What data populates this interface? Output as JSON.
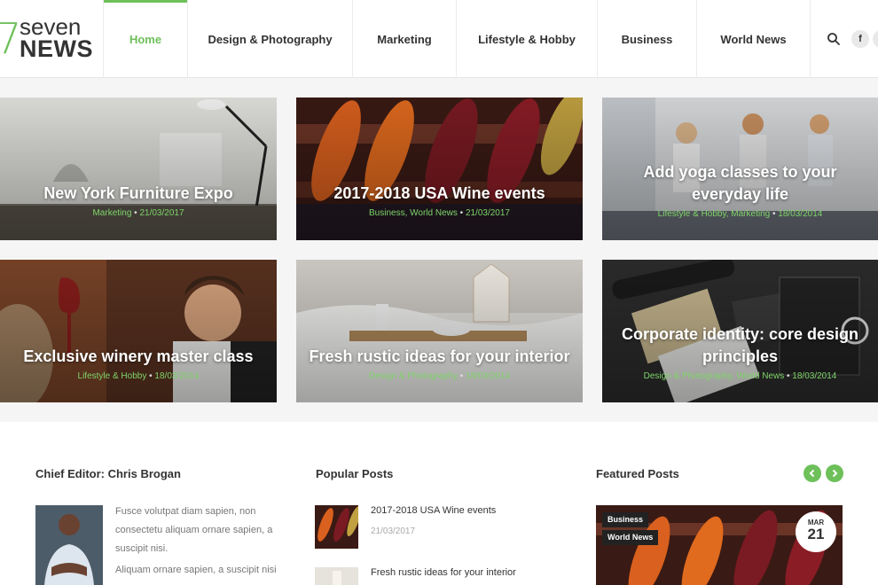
{
  "logo": {
    "line1": "seven",
    "line2": "NEWS"
  },
  "nav": [
    {
      "label": "Home",
      "active": true
    },
    {
      "label": "Design & Photography",
      "active": false
    },
    {
      "label": "Marketing",
      "active": false
    },
    {
      "label": "Lifestyle & Hobby",
      "active": false
    },
    {
      "label": "Business",
      "active": false
    },
    {
      "label": "World News",
      "active": false
    }
  ],
  "social": {
    "facebook": "f"
  },
  "tiles": [
    {
      "title": "New York Furniture Expo",
      "cats": "Marketing",
      "date": "21/03/2017"
    },
    {
      "title": "2017-2018 USA Wine events",
      "cats": "Business, World News",
      "date": "21/03/2017"
    },
    {
      "title": "Add yoga classes to your everyday life",
      "cats": "Lifestyle & Hobby, Marketing",
      "date": "18/03/2014"
    },
    {
      "title": "Exclusive winery master class",
      "cats": "Lifestyle & Hobby",
      "date": "18/03/2014"
    },
    {
      "title": "Fresh rustic ideas for your interior",
      "cats": "Design & Photography",
      "date": "18/03/2014"
    },
    {
      "title": "Corporate identity: core design principles",
      "cats": "Design & Photography, World News",
      "date": "18/03/2014"
    }
  ],
  "editor": {
    "heading": "Chief Editor: Chris Brogan",
    "para1": "Fusce volutpat diam sapien, non consectetu aliquam ornare sapien, a suscipit nisi.",
    "para2": "Aliquam ornare sapien, a suscipit nisi"
  },
  "popular": {
    "heading": "Popular Posts",
    "items": [
      {
        "title": "2017-2018 USA Wine events",
        "date": "21/03/2017"
      },
      {
        "title": "Fresh rustic ideas for your interior",
        "date": ""
      }
    ]
  },
  "featured": {
    "heading": "Featured Posts",
    "badges": [
      "Business",
      "World News"
    ],
    "month": "MAR",
    "day": "21"
  },
  "colors": {
    "accent": "#6ec05a",
    "text": "#333333"
  }
}
